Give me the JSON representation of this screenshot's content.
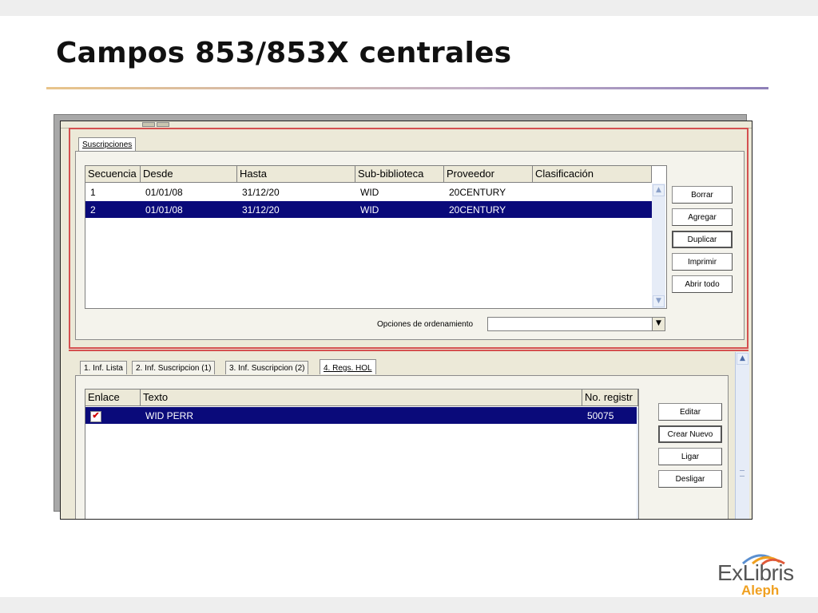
{
  "slide": {
    "title": "Campos 853/853X centrales"
  },
  "upper": {
    "tab_label": "Suscripciones",
    "columns": [
      "Secuencia",
      "Desde",
      "Hasta",
      "Sub-biblioteca",
      "Proveedor",
      "Clasificación"
    ],
    "rows": [
      {
        "secuencia": "1",
        "desde": "01/01/08",
        "hasta": "31/12/20",
        "sub": "WID",
        "proveedor": "20CENTURY",
        "clasificacion": "",
        "selected": false
      },
      {
        "secuencia": "2",
        "desde": "01/01/08",
        "hasta": "31/12/20",
        "sub": "WID",
        "proveedor": "20CENTURY",
        "clasificacion": "",
        "selected": true
      }
    ],
    "buttons": {
      "borrar": "Borrar",
      "agregar": "Agregar",
      "duplicar": "Duplicar",
      "imprimir": "Imprimir",
      "abrir_todo": "Abrir todo"
    },
    "sort_label": "Opciones de ordenamiento",
    "sort_value": ""
  },
  "lower": {
    "tabs": [
      "1. Inf. Lista",
      "2. Inf. Suscripcion (1)",
      "3. Inf. Suscripcion (2)",
      "4. Regs. HOL"
    ],
    "active_tab": "4. Regs. HOL",
    "columns": [
      "Enlace",
      "Texto",
      "No. registr"
    ],
    "rows": [
      {
        "enlace_checked": true,
        "texto": "WID PERR",
        "no_registro": "50075",
        "selected": true
      }
    ],
    "buttons": {
      "editar": "Editar",
      "crear_nuevo": "Crear Nuevo",
      "ligar": "Ligar",
      "desligar": "Desligar"
    }
  },
  "logo": {
    "brand": "ExLibris",
    "product": "Aleph"
  },
  "colors": {
    "selection": "#0a0a7a",
    "highlight_frame": "#d45050",
    "aleph": "#f0a020"
  }
}
